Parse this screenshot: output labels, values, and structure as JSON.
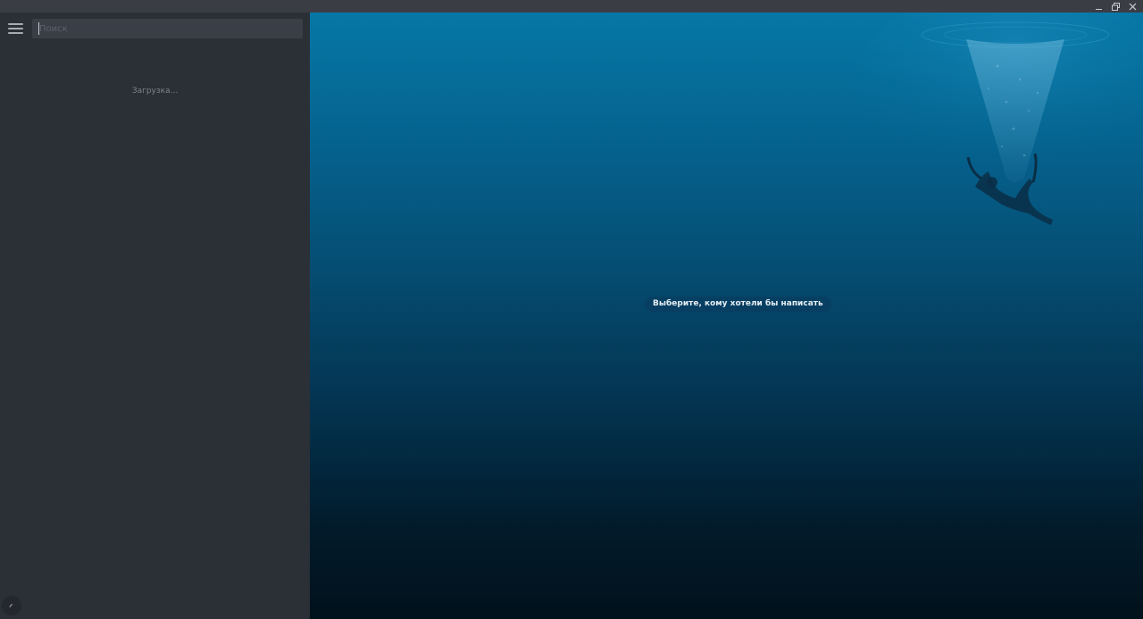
{
  "window": {
    "controls": [
      "minimize-icon",
      "restore-icon",
      "close-icon"
    ]
  },
  "sidebar": {
    "search": {
      "placeholder": "Поиск",
      "value": ""
    },
    "loading_text": "Загрузка..."
  },
  "main": {
    "empty_state_text": "Выберите, кому хотели бы написать"
  },
  "colors": {
    "sidebar_bg": "#2b2f36",
    "titlebar_bg": "#3a3d44",
    "search_bg": "#3a3e46",
    "wallpaper_top": "#0677a6",
    "wallpaper_bottom": "#01111b"
  }
}
